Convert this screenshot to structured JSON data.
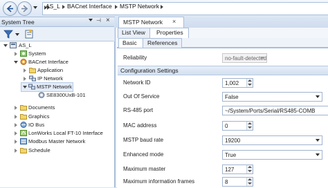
{
  "breadcrumb": {
    "items": [
      "AS_L",
      "BACnet Interface",
      "MSTP Network"
    ]
  },
  "left_panel": {
    "title": "System Tree",
    "tree": [
      {
        "label": "AS_L"
      },
      {
        "label": "System"
      },
      {
        "label": "BACnet Interface"
      },
      {
        "label": "Application"
      },
      {
        "label": "IP Network"
      },
      {
        "label": "MSTP Network"
      },
      {
        "label": "SE8300UxB-101"
      },
      {
        "label": "Documents"
      },
      {
        "label": "Graphics"
      },
      {
        "label": "IO Bus"
      },
      {
        "label": "LonWorks Local FT-10 Interface"
      },
      {
        "label": "Modbus Master Network"
      },
      {
        "label": "Schedule"
      }
    ]
  },
  "document_tab": {
    "title": "MSTP Network",
    "close_glyph": "×"
  },
  "view_tabs": [
    "List View",
    "Properties"
  ],
  "sub_tabs": [
    "Basic",
    "References"
  ],
  "properties": {
    "reliability": {
      "label": "Reliability",
      "value": "no-fault-detected"
    },
    "section_title": "Configuration Settings",
    "rows": [
      {
        "label": "Network ID",
        "value": "1,002"
      },
      {
        "label": "Out Of Service",
        "value": "False"
      },
      {
        "label": "RS-485 port",
        "value": "~/System/Ports/Serial/RS485-COMB"
      },
      {
        "label": "MAC address",
        "value": "0"
      },
      {
        "label": "MSTP baud rate",
        "value": "19200"
      },
      {
        "label": "Enhanced mode",
        "value": "True"
      },
      {
        "label": "Maximum master",
        "value": "127"
      },
      {
        "label": "Maximum information frames",
        "value": "8"
      }
    ]
  },
  "colors": {
    "accent": "#2f6fbf",
    "panel_border": "#a9bdd8"
  }
}
